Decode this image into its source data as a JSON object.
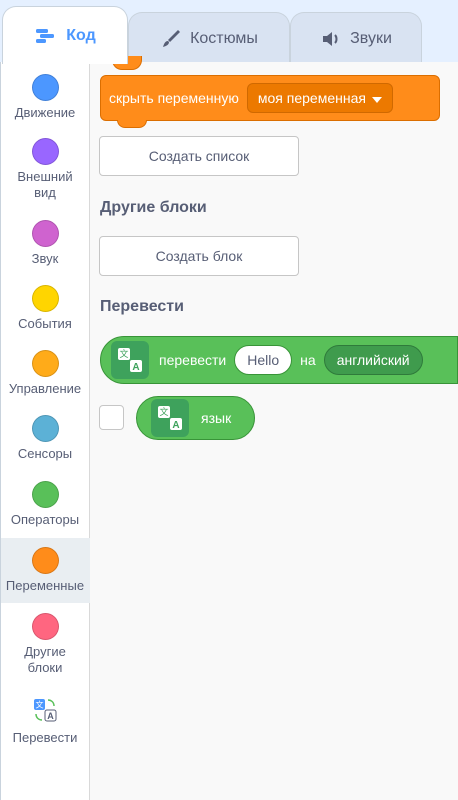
{
  "tabs": [
    {
      "label": "Код",
      "icon": "code-icon",
      "active": true
    },
    {
      "label": "Костюмы",
      "icon": "brush-icon",
      "active": false
    },
    {
      "label": "Звуки",
      "icon": "speaker-icon",
      "active": false
    }
  ],
  "categories": [
    {
      "label": "Движение",
      "color": "#4c97ff"
    },
    {
      "label": "Внешний вид",
      "color": "#9966ff"
    },
    {
      "label": "Звук",
      "color": "#cf63cf"
    },
    {
      "label": "События",
      "color": "#ffd500"
    },
    {
      "label": "Управление",
      "color": "#ffab19"
    },
    {
      "label": "Сенсоры",
      "color": "#5cb1d6"
    },
    {
      "label": "Операторы",
      "color": "#59c059"
    },
    {
      "label": "Переменные",
      "color": "#ff8c1a",
      "selected": true
    },
    {
      "label": "Другие блоки",
      "color": "#ff6680"
    },
    {
      "label": "Перевести",
      "icon": "translate-icon"
    }
  ],
  "variables": {
    "hide_block_label": "скрыть переменную",
    "hide_block_dropdown": "моя переменная",
    "make_list_button": "Создать список"
  },
  "my_blocks": {
    "title": "Другие блоки",
    "make_block_button": "Создать блок"
  },
  "translate": {
    "title": "Перевести",
    "translate_block_label": "перевести",
    "translate_input_value": "Hello",
    "translate_block_to": "на",
    "translate_language_dropdown": "английский",
    "language_reporter_label": "язык"
  },
  "colors": {
    "variables": "#ff8c1a",
    "extension_green": "#59c059",
    "accent": "#4c97ff"
  }
}
